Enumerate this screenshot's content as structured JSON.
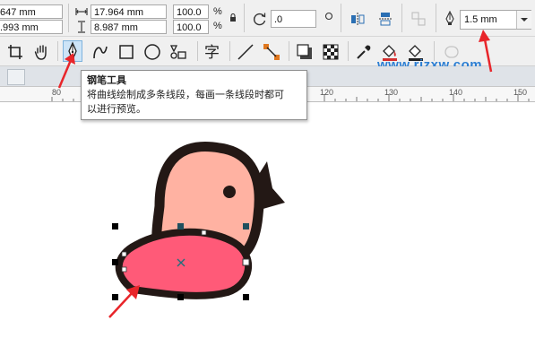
{
  "property_bar": {
    "x_value": "647 mm",
    "y_value": ".993 mm",
    "width_value": "17.964 mm",
    "height_value": "8.987 mm",
    "scale_w": "100.0",
    "scale_h": "100.0",
    "percent": "%",
    "rotation_value": ".0",
    "outline_width": "1.5 mm"
  },
  "tooltip": {
    "title": "钢笔工具",
    "line1": "将曲线绘制成多条线段，每画一条线段时都可",
    "line2": "以进行预览。"
  },
  "ruler": {
    "ticks": [
      "80",
      "120",
      "130",
      "140",
      "150"
    ]
  },
  "watermark": "www.rjzxw.com",
  "colors": {
    "bird_body": "#ffb2a2",
    "bird_outline": "#231815",
    "wing_fill": "#ff5a78",
    "arrow_red": "#e8252a",
    "watermark": "#2d7fd3"
  },
  "icons": [
    "crop-icon",
    "hand-pan-icon",
    "pen-tool-icon",
    "curve-icon",
    "rectangle-icon",
    "ellipse-icon",
    "polygon-icon",
    "text-icon",
    "line-icon",
    "connector-icon",
    "shadow-icon",
    "transparency-icon",
    "eyedropper-icon",
    "fill-icon",
    "smart-fill-icon"
  ]
}
